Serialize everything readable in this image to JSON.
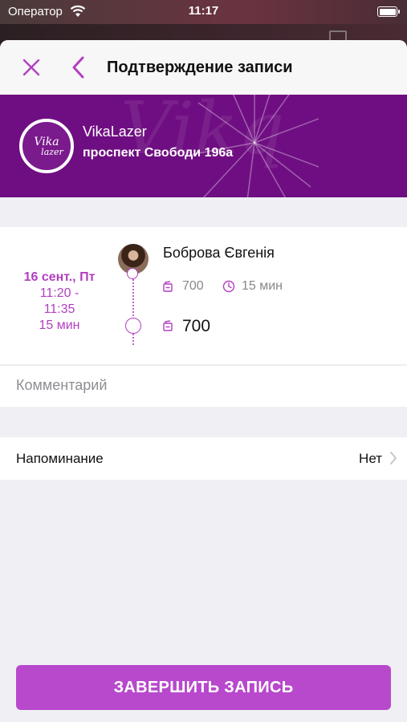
{
  "status_bar": {
    "carrier": "Оператор",
    "time": "11:17",
    "battery_percent": 100
  },
  "nav": {
    "title": "Подтверждение записи",
    "close_icon": "close-icon",
    "back_icon": "chevron-left-icon"
  },
  "salon": {
    "logo_line1": "Vika",
    "logo_line2": "lazer",
    "name": "VikaLazer",
    "address": "проспект Свободи 196а"
  },
  "booking": {
    "date": "16 сент., Пт",
    "time_start": "11:20 -",
    "time_end": "11:35",
    "duration": "15 мин",
    "master_name": "Боброва Євгенія",
    "service_price": "700",
    "service_duration": "15 мин",
    "total": "700"
  },
  "comment": {
    "placeholder": "Комментарий",
    "value": ""
  },
  "reminder": {
    "label": "Напоминание",
    "value": "Нет"
  },
  "submit": {
    "label": "ЗАВЕРШИТЬ ЗАПИСЬ"
  },
  "colors": {
    "accent": "#b848cc",
    "banner": "#6f0e82",
    "background": "#efeff4"
  }
}
